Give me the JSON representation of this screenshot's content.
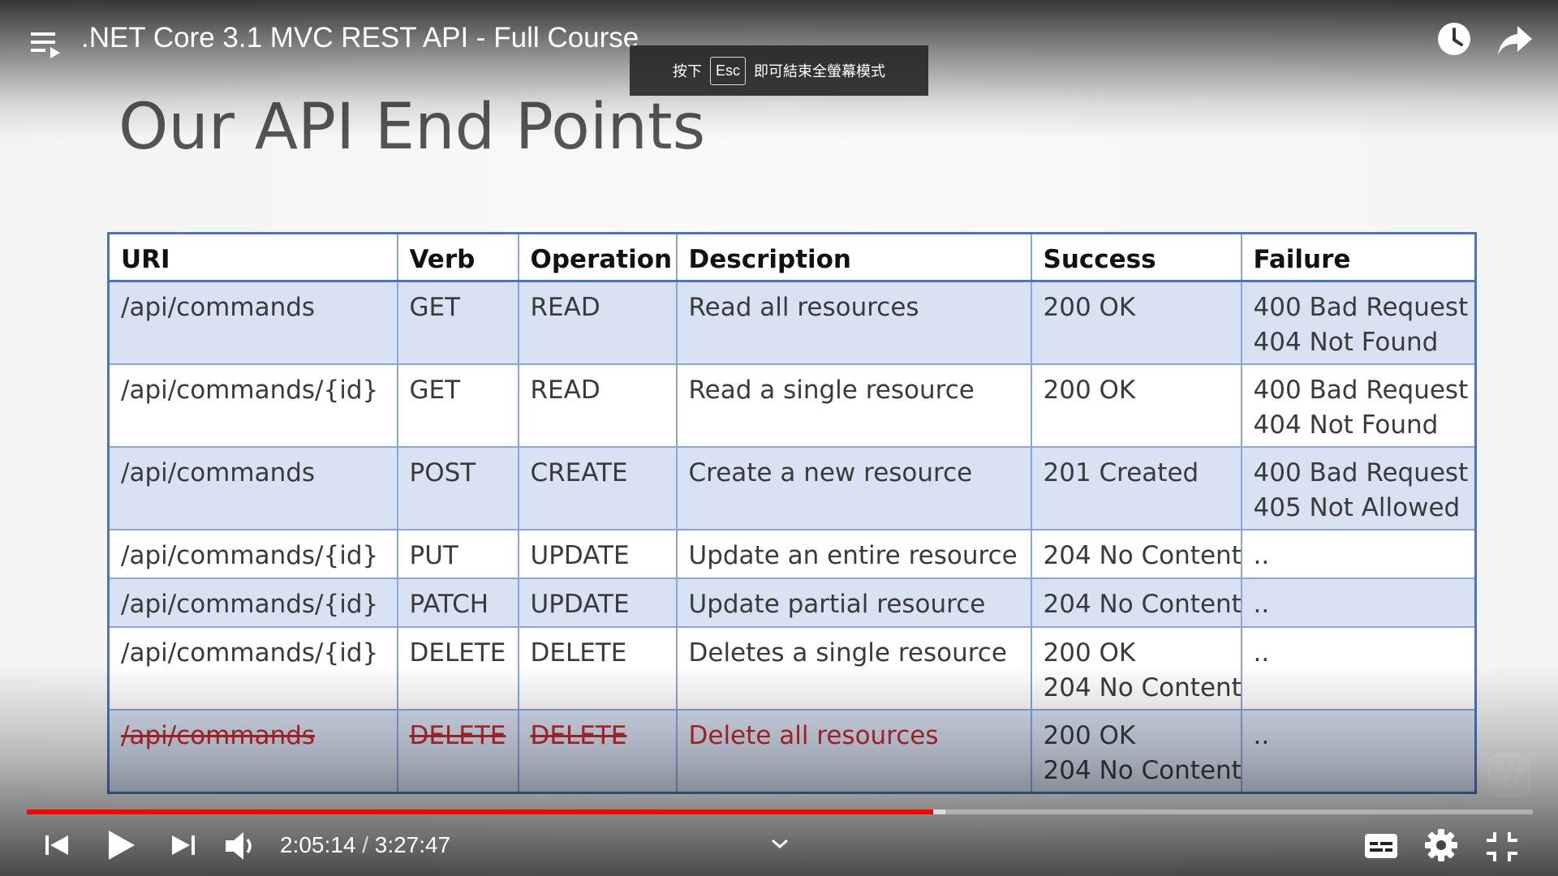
{
  "player": {
    "title": ".NET Core 3.1 MVC REST API - Full Course",
    "current_time": "2:05:14",
    "separator": " / ",
    "duration": "3:27:47",
    "progress_played_fraction": 0.602,
    "progress_buffered_fraction": 0.61,
    "accent_color": "#ff0000"
  },
  "toast": {
    "prefix": "按下",
    "key": "Esc",
    "suffix": "即可結束全螢幕模式"
  },
  "slide": {
    "title": "Our API End Points",
    "headers": [
      "URI",
      "Verb",
      "Operation",
      "Description",
      "Success",
      "Failure"
    ],
    "rows": [
      {
        "uri": "/api/commands",
        "verb": "GET",
        "operation": "READ",
        "description": "Read all resources",
        "success": [
          "200 OK"
        ],
        "failure": [
          "400 Bad Request",
          "404 Not Found"
        ]
      },
      {
        "uri": "/api/commands/{id}",
        "verb": "GET",
        "operation": "READ",
        "description": "Read a single resource",
        "success": [
          "200 OK"
        ],
        "failure": [
          "400 Bad Request",
          "404 Not Found"
        ]
      },
      {
        "uri": "/api/commands",
        "verb": "POST",
        "operation": "CREATE",
        "description": "Create a new resource",
        "success": [
          "201 Created"
        ],
        "failure": [
          "400 Bad Request",
          "405 Not Allowed"
        ]
      },
      {
        "uri": "/api/commands/{id}",
        "verb": "PUT",
        "operation": "UPDATE",
        "description": "Update an entire resource",
        "success": [
          "204 No Content"
        ],
        "failure": [
          ".."
        ]
      },
      {
        "uri": "/api/commands/{id}",
        "verb": "PATCH",
        "operation": "UPDATE",
        "description": "Update partial resource",
        "success": [
          "204 No Content"
        ],
        "failure": [
          ".."
        ]
      },
      {
        "uri": "/api/commands/{id}",
        "verb": "DELETE",
        "operation": "DELETE",
        "description": "Deletes a single resource",
        "success": [
          "200 OK",
          "204 No Content"
        ],
        "failure": [
          ".."
        ]
      },
      {
        "uri": "/api/commands",
        "verb": "DELETE",
        "operation": "DELETE",
        "description": "Delete all resources",
        "success": [
          "200 OK",
          "204 No Content"
        ],
        "failure": [
          ".."
        ]
      }
    ]
  },
  "icons": {
    "menu": "playlist-menu-icon",
    "watch_later": "clock-icon",
    "share": "share-arrow-icon",
    "prev": "skip-previous-icon",
    "play": "play-icon",
    "next": "skip-next-icon",
    "volume": "volume-icon",
    "chevron": "chevron-down-icon",
    "subtitles": "subtitles-icon",
    "settings": "gear-icon",
    "exit_fullscreen": "exit-fullscreen-icon"
  }
}
